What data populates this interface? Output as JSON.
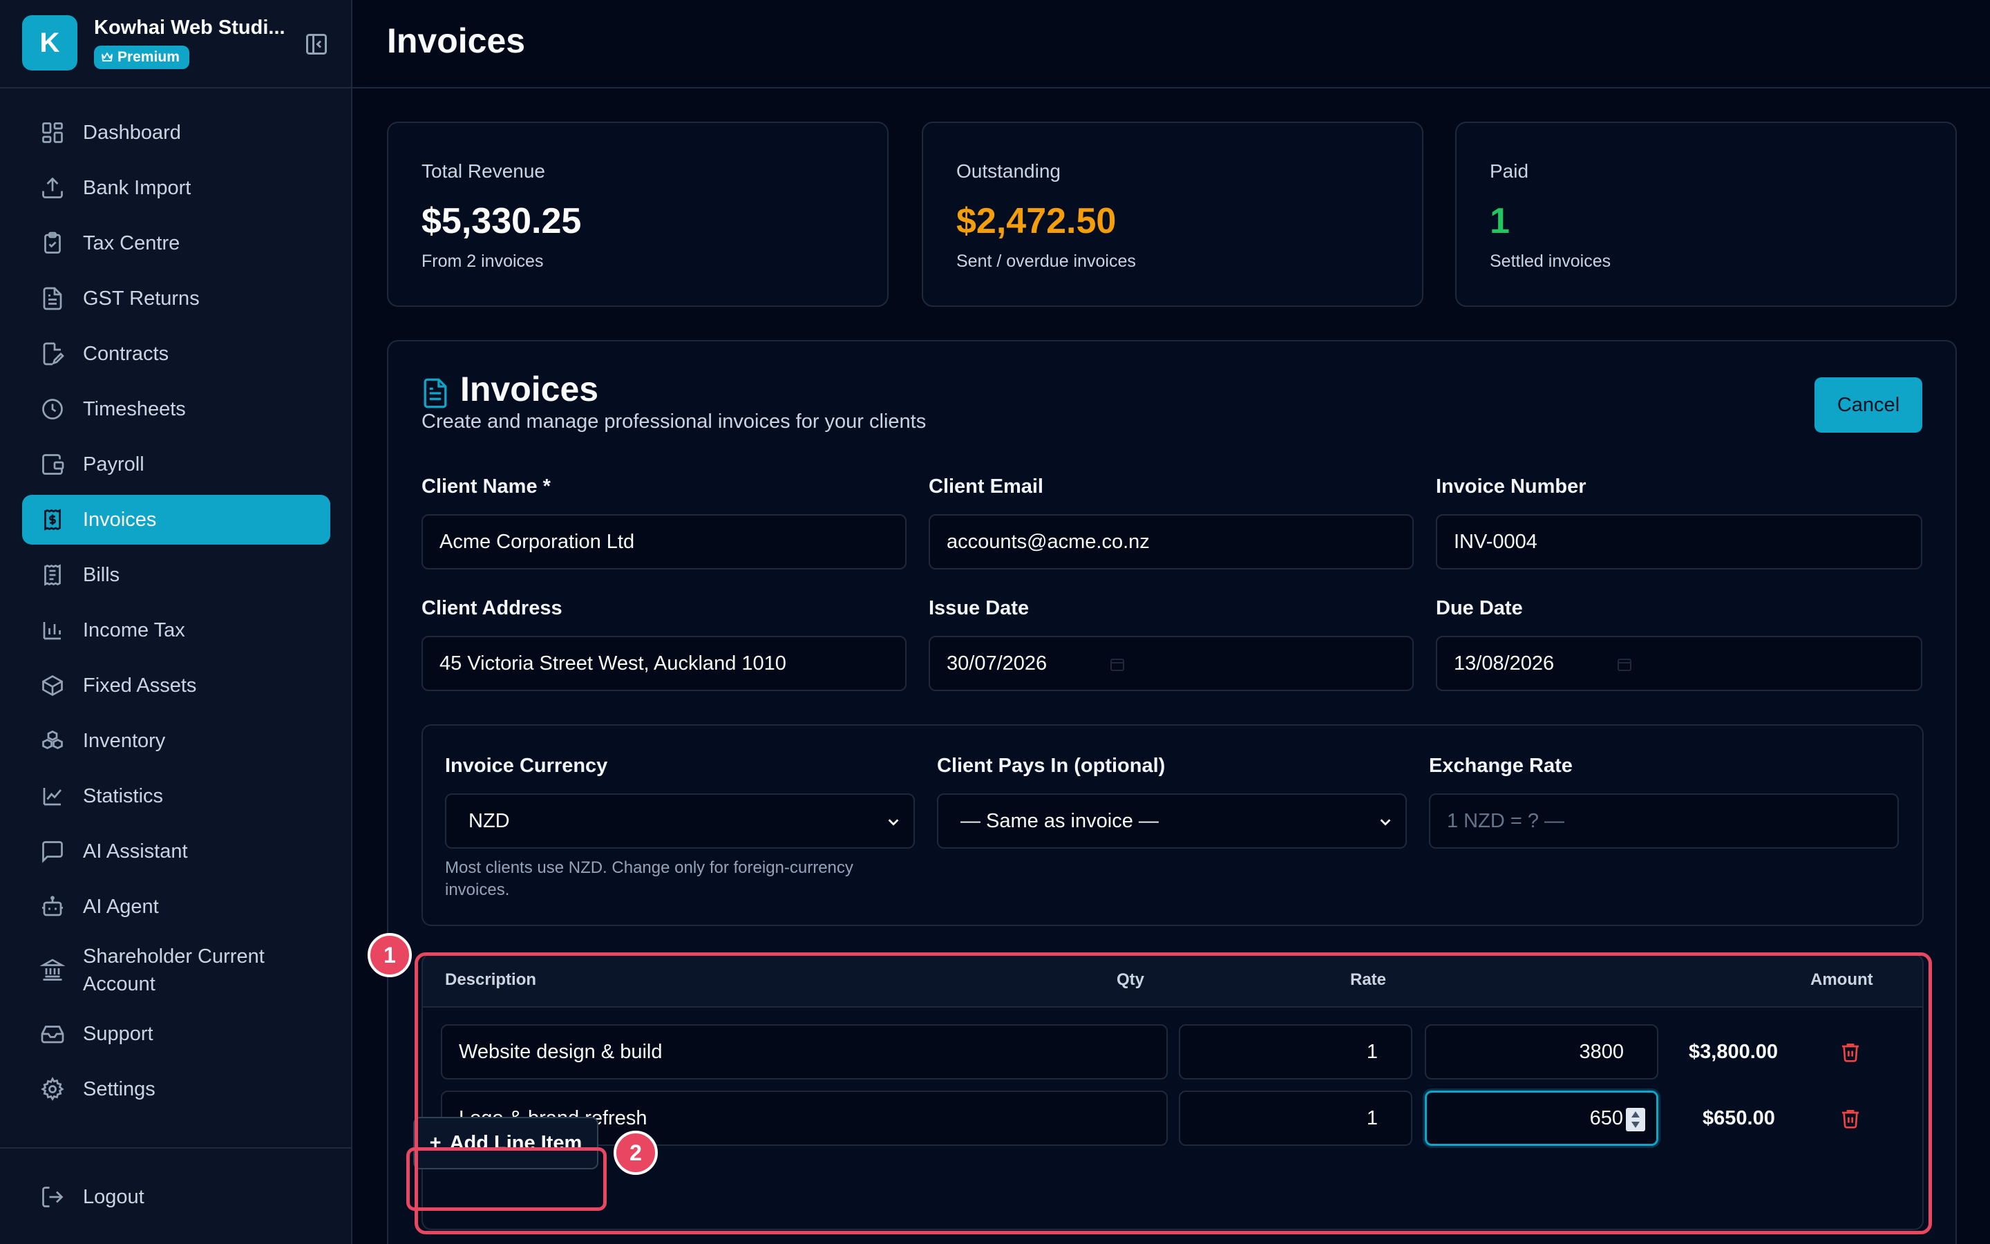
{
  "brand": {
    "logo_letter": "K",
    "name": "Kowhai Web Studi...",
    "badge": "Premium"
  },
  "sidebar": {
    "items": [
      {
        "label": "Dashboard",
        "icon": "dashboard-icon"
      },
      {
        "label": "Bank Import",
        "icon": "upload-icon"
      },
      {
        "label": "Tax Centre",
        "icon": "clipboard-check-icon"
      },
      {
        "label": "GST Returns",
        "icon": "document-icon"
      },
      {
        "label": "Contracts",
        "icon": "file-signature-icon"
      },
      {
        "label": "Timesheets",
        "icon": "clock-icon"
      },
      {
        "label": "Payroll",
        "icon": "wallet-icon"
      },
      {
        "label": "Invoices",
        "icon": "receipt-dollar-icon"
      },
      {
        "label": "Bills",
        "icon": "receipt-icon"
      },
      {
        "label": "Income Tax",
        "icon": "bar-chart-icon"
      },
      {
        "label": "Fixed Assets",
        "icon": "box-icon"
      },
      {
        "label": "Inventory",
        "icon": "boxes-icon"
      },
      {
        "label": "Statistics",
        "icon": "line-chart-icon"
      },
      {
        "label": "AI Assistant",
        "icon": "chat-icon"
      },
      {
        "label": "AI Agent",
        "icon": "robot-icon"
      },
      {
        "label": "Shareholder Current Account",
        "icon": "bank-icon"
      },
      {
        "label": "Support",
        "icon": "inbox-icon"
      },
      {
        "label": "Settings",
        "icon": "gear-icon"
      }
    ],
    "active_index": 7,
    "logout": "Logout"
  },
  "header": {
    "title": "Invoices"
  },
  "stats": {
    "revenue": {
      "label": "Total Revenue",
      "value": "$5,330.25",
      "sub": "From 2 invoices",
      "color": "#ffffff"
    },
    "outstanding": {
      "label": "Outstanding",
      "value": "$2,472.50",
      "sub": "Sent / overdue invoices",
      "color": "#f59e0b"
    },
    "paid": {
      "label": "Paid",
      "value": "1",
      "sub": "Settled invoices",
      "color": "#22c55e"
    }
  },
  "panel": {
    "title": "Invoices",
    "subtitle": "Create and manage professional invoices for your clients",
    "cancel": "Cancel"
  },
  "form": {
    "client_name": {
      "label": "Client Name *",
      "value": "Acme Corporation Ltd"
    },
    "client_email": {
      "label": "Client Email",
      "value": "accounts@acme.co.nz"
    },
    "invoice_number": {
      "label": "Invoice Number",
      "value": "INV-0004"
    },
    "client_address": {
      "label": "Client Address",
      "value": "45 Victoria Street West, Auckland 1010"
    },
    "issue_date": {
      "label": "Issue Date",
      "value": "30/07/2026"
    },
    "due_date": {
      "label": "Due Date",
      "value": "13/08/2026"
    }
  },
  "currency": {
    "invoice_currency": {
      "label": "Invoice Currency",
      "value": "NZD"
    },
    "client_pays_in": {
      "label": "Client Pays In (optional)",
      "value": "— Same as invoice —"
    },
    "exchange_rate": {
      "label": "Exchange Rate",
      "placeholder": "1 NZD = ? —"
    },
    "helper": "Most clients use NZD. Change only for foreign-currency invoices."
  },
  "line_items": {
    "headers": {
      "description": "Description",
      "qty": "Qty",
      "rate": "Rate",
      "amount": "Amount"
    },
    "rows": [
      {
        "description": "Website design & build",
        "qty": "1",
        "rate": "3800",
        "amount": "$3,800.00"
      },
      {
        "description": "Logo & brand refresh",
        "qty": "1",
        "rate": "650",
        "amount": "$650.00"
      }
    ],
    "add_label": "Add Line Item"
  },
  "annotations": {
    "one": "1",
    "two": "2",
    "color": "#e84661"
  }
}
